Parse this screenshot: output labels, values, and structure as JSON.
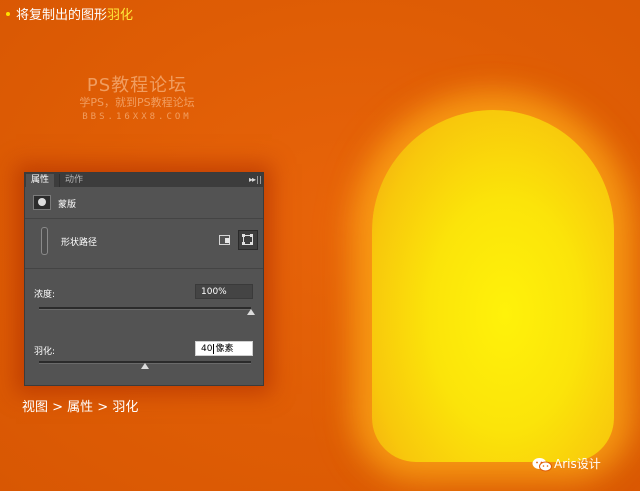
{
  "instruction": {
    "prefix": "将复制出的图形",
    "highlight": "羽化"
  },
  "watermark": {
    "title": "PS教程论坛",
    "subtitle": "学PS，就到PS教程论坛",
    "url": "BBS.16XX8.COM"
  },
  "panel": {
    "tabs": [
      {
        "label": "属性",
        "active": true
      },
      {
        "label": "动作",
        "active": false
      }
    ],
    "menu_glyph": "▸▸",
    "mask": {
      "label": "蒙版",
      "icon": "mask-icon"
    },
    "shape": {
      "label": "形状路径",
      "icons": [
        "select-mask-icon",
        "transform-icon"
      ]
    },
    "density": {
      "label": "浓度:",
      "value": "100%",
      "slider_fraction": 1.0
    },
    "feather": {
      "label": "羽化:",
      "value": "40",
      "unit": "像素",
      "slider_fraction": 0.5
    }
  },
  "breadcrumb": "视图 > 属性 > 羽化",
  "brand": {
    "label": "Aris设计",
    "icon": "wechat-icon"
  },
  "colors": {
    "background": "#df5d05",
    "capsule_center": "#fff20a",
    "capsule_edge": "#f2a012",
    "panel": "#535353",
    "highlight_text": "#ffe83a"
  }
}
